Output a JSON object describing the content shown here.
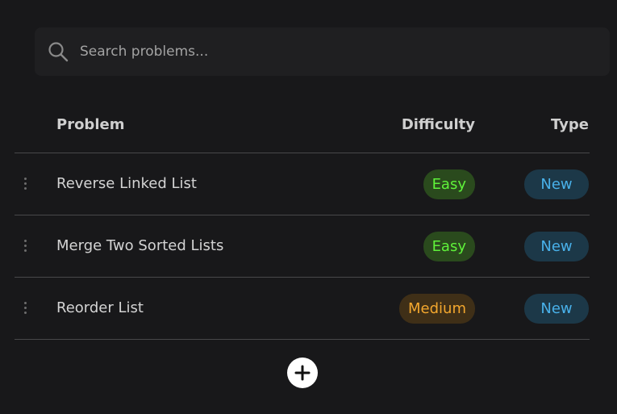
{
  "search": {
    "placeholder": "Search problems..."
  },
  "table": {
    "headers": {
      "problem": "Problem",
      "difficulty": "Difficulty",
      "type": "Type"
    },
    "rows": [
      {
        "name": "Reverse Linked List",
        "difficulty": "Easy",
        "type": "New"
      },
      {
        "name": "Merge Two Sorted Lists",
        "difficulty": "Easy",
        "type": "New"
      },
      {
        "name": "Reorder List",
        "difficulty": "Medium",
        "type": "New"
      }
    ]
  },
  "icons": {
    "search": "search-icon",
    "drag": "drag-handle-icon",
    "add": "plus-icon"
  },
  "colors": {
    "background": "#18181a",
    "search_bg": "#1f1f21",
    "easy_text": "#5ff23a",
    "easy_bg": "#2a4a1d",
    "medium_text": "#f3a72e",
    "medium_bg": "#3f2f17",
    "new_text": "#49b1ea",
    "new_bg": "#1c3848"
  }
}
